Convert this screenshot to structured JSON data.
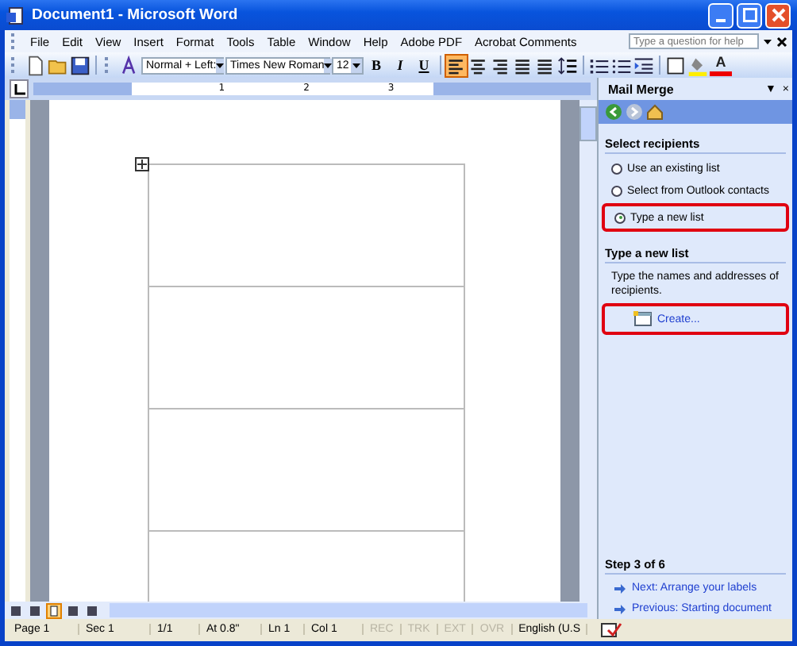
{
  "window": {
    "title": "Document1 - Microsoft Word"
  },
  "menu": {
    "items": [
      "File",
      "Edit",
      "View",
      "Insert",
      "Format",
      "Tools",
      "Table",
      "Window",
      "Help",
      "Adobe PDF",
      "Acrobat Comments"
    ],
    "help_box": {
      "placeholder": "Type a question for help"
    }
  },
  "toolbar": {
    "style": "Normal + Left:",
    "font": "Times New Roman",
    "size": "12",
    "buttons": [
      {
        "kind": "new"
      },
      {
        "kind": "open"
      },
      {
        "kind": "save"
      },
      {
        "kind": "styles"
      }
    ],
    "format": [
      {
        "label": "B",
        "kind": "bold"
      },
      {
        "label": "I",
        "kind": "italic"
      },
      {
        "label": "U",
        "kind": "underline"
      }
    ],
    "align": [
      {
        "kind": "left",
        "selected": true
      },
      {
        "kind": "center",
        "selected": false
      },
      {
        "kind": "right",
        "selected": false
      },
      {
        "kind": "justify",
        "selected": false
      },
      {
        "kind": "distributed",
        "selected": false
      }
    ],
    "font_color": "A"
  },
  "ruler": {
    "numbers": [
      "1",
      "2",
      "3"
    ]
  },
  "task_pane": {
    "title": "Mail Merge",
    "menu_glyph": "▼",
    "close_glyph": "×",
    "sections": [
      {
        "heading": "Select recipients",
        "options": [
          {
            "label": "Use an existing list",
            "selected": false,
            "highlighted": false
          },
          {
            "label": "Select from Outlook contacts",
            "selected": false,
            "highlighted": false
          },
          {
            "label": "Type a new list",
            "selected": true,
            "highlighted": true
          }
        ]
      },
      {
        "heading": "Type a new list",
        "text": "Type the names and addresses of recipients.",
        "link": {
          "label": "Create...",
          "highlighted": true
        }
      }
    ],
    "step": "Step 3 of 6",
    "nav": [
      "Next: Arrange your labels",
      "Previous: Starting document"
    ]
  },
  "status_bar": [
    {
      "text": "Page 1",
      "disabled": false
    },
    {
      "text": "Sec 1",
      "disabled": false
    },
    {
      "text": "1/1",
      "disabled": false
    },
    {
      "text": "At 0.8\"",
      "disabled": false
    },
    {
      "text": "Ln 1",
      "disabled": false
    },
    {
      "text": "Col 1",
      "disabled": false
    },
    {
      "text": "REC",
      "disabled": true
    },
    {
      "text": "TRK",
      "disabled": true
    },
    {
      "text": "EXT",
      "disabled": true
    },
    {
      "text": "OVR",
      "disabled": true
    },
    {
      "text": "English (U.S",
      "disabled": false
    }
  ]
}
